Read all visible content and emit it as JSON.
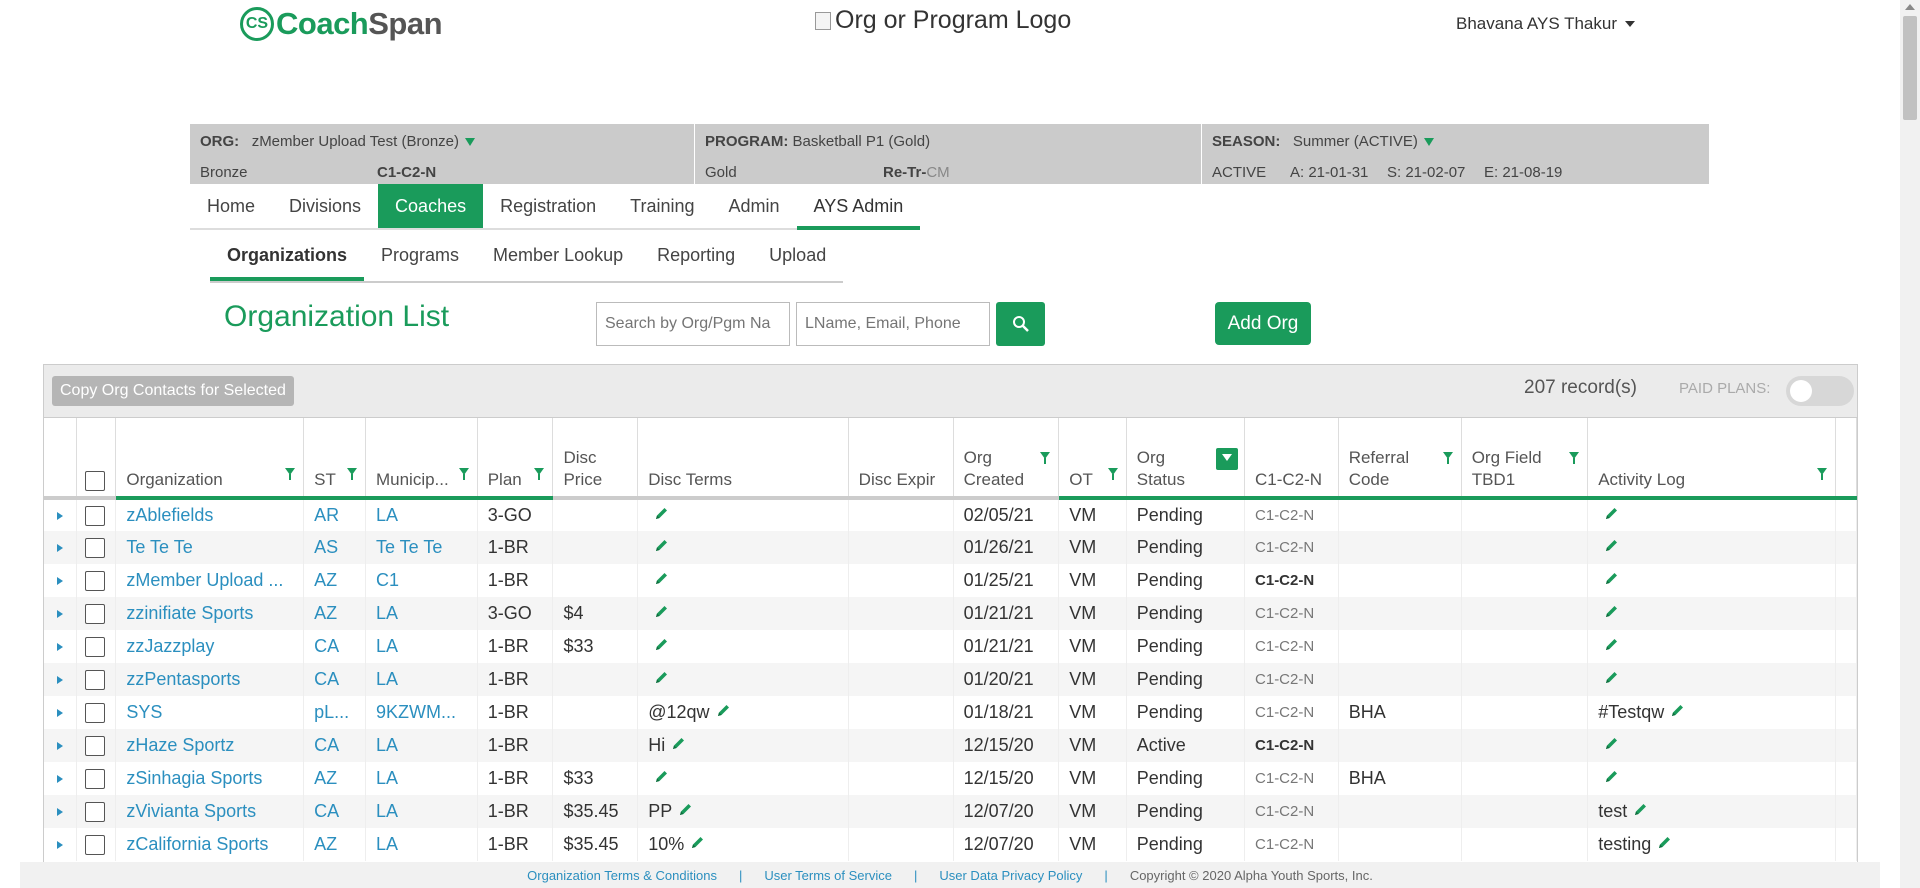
{
  "header": {
    "logo_mark": "CS",
    "logo_c": "Coach",
    "logo_span": "Span",
    "org_logo_alt": "Org or Program Logo",
    "user_name": "Bhavana AYS Thakur"
  },
  "context": {
    "org_label": "ORG:",
    "org_value": "zMember Upload Test (Bronze)",
    "org_level": "Bronze",
    "org_code": "C1-C2-N",
    "program_label": "PROGRAM:",
    "program_value": "Basketball P1 (Gold)",
    "program_level": "Gold",
    "program_code_bold": "Re-Tr-",
    "program_code_light": "CM",
    "season_label": "SEASON:",
    "season_value": "Summer (ACTIVE)",
    "season_status": "ACTIVE",
    "season_a": "A: 21-01-31",
    "season_s": "S: 21-02-07",
    "season_e": "E: 21-08-19"
  },
  "nav": [
    "Home",
    "Divisions",
    "Coaches",
    "Registration",
    "Training",
    "Admin",
    "AYS Admin"
  ],
  "subnav": [
    "Organizations",
    "Programs",
    "Member Lookup",
    "Reporting",
    "Upload"
  ],
  "page_title": "Organization List",
  "search": {
    "org_placeholder": "Search by Org/Pgm Na",
    "contact_placeholder": "LName, Email, Phone"
  },
  "add_org_label": "Add Org",
  "toolbar": {
    "copy_label": "Copy Org Contacts for Selected",
    "records": "207 record(s)",
    "paid_plans_label": "PAID PLANS:"
  },
  "columns": {
    "organization": "Organization",
    "st": "ST",
    "municipality": "Municip...",
    "plan": "Plan",
    "disc_price_1": "Disc",
    "disc_price_2": "Price",
    "disc_terms": "Disc Terms",
    "disc_expir": "Disc Expir",
    "org_created_1": "Org",
    "org_created_2": "Created",
    "ot": "OT",
    "org_status_1": "Org",
    "org_status_2": "Status",
    "c1c2n": "C1-C2-N",
    "referral_1": "Referral",
    "referral_2": "Code",
    "field_1": "Org Field",
    "field_2": "TBD1",
    "activity": "Activity Log"
  },
  "rows": [
    {
      "org": "zAblefields",
      "st": "AR",
      "muni": "LA",
      "plan": "3-GO",
      "price": "",
      "terms": "",
      "created": "02/05/21",
      "ot": "VM",
      "status": "Pending",
      "code": "C1-C2-N",
      "code_bold": false,
      "ref": "",
      "field": "",
      "activity": ""
    },
    {
      "org": "Te Te Te",
      "st": "AS",
      "muni": "Te Te Te",
      "plan": "1-BR",
      "price": "",
      "terms": "",
      "created": "01/26/21",
      "ot": "VM",
      "status": "Pending",
      "code": "C1-C2-N",
      "code_bold": false,
      "ref": "",
      "field": "",
      "activity": ""
    },
    {
      "org": "zMember Upload ...",
      "st": "AZ",
      "muni": "C1",
      "plan": "1-BR",
      "price": "",
      "terms": "",
      "created": "01/25/21",
      "ot": "VM",
      "status": "Pending",
      "code": "C1-C2-N",
      "code_bold": true,
      "ref": "",
      "field": "",
      "activity": ""
    },
    {
      "org": "zzinifiate Sports",
      "st": "AZ",
      "muni": "LA",
      "plan": "3-GO",
      "price": "$4",
      "terms": "",
      "created": "01/21/21",
      "ot": "VM",
      "status": "Pending",
      "code": "C1-C2-N",
      "code_bold": false,
      "ref": "",
      "field": "",
      "activity": ""
    },
    {
      "org": "zzJazzplay",
      "st": "CA",
      "muni": "LA",
      "plan": "1-BR",
      "price": "$33",
      "terms": "",
      "created": "01/21/21",
      "ot": "VM",
      "status": "Pending",
      "code": "C1-C2-N",
      "code_bold": false,
      "ref": "",
      "field": "",
      "activity": ""
    },
    {
      "org": "zzPentasports",
      "st": "CA",
      "muni": "LA",
      "plan": "1-BR",
      "price": "",
      "terms": "",
      "created": "01/20/21",
      "ot": "VM",
      "status": "Pending",
      "code": "C1-C2-N",
      "code_bold": false,
      "ref": "",
      "field": "",
      "activity": ""
    },
    {
      "org": "SYS",
      "st": "pL...",
      "muni": "9KZWM...",
      "plan": "1-BR",
      "price": "",
      "terms": "@12qw",
      "created": "01/18/21",
      "ot": "VM",
      "status": "Pending",
      "code": "C1-C2-N",
      "code_bold": false,
      "ref": "BHA",
      "field": "",
      "activity": "#Testqw"
    },
    {
      "org": "zHaze Sportz",
      "st": "CA",
      "muni": "LA",
      "plan": "1-BR",
      "price": "",
      "terms": "Hi",
      "created": "12/15/20",
      "ot": "VM",
      "status": "Active",
      "code": "C1-C2-N",
      "code_bold": true,
      "ref": "",
      "field": "",
      "activity": ""
    },
    {
      "org": "zSinhagia Sports",
      "st": "AZ",
      "muni": "LA",
      "plan": "1-BR",
      "price": "$33",
      "terms": "",
      "created": "12/15/20",
      "ot": "VM",
      "status": "Pending",
      "code": "C1-C2-N",
      "code_bold": false,
      "ref": "BHA",
      "field": "",
      "activity": ""
    },
    {
      "org": "zVivianta Sports",
      "st": "CA",
      "muni": "LA",
      "plan": "1-BR",
      "price": "$35.45",
      "terms": "PP",
      "created": "12/07/20",
      "ot": "VM",
      "status": "Pending",
      "code": "C1-C2-N",
      "code_bold": false,
      "ref": "",
      "field": "",
      "activity": "test"
    },
    {
      "org": "zCalifornia Sports",
      "st": "AZ",
      "muni": "LA",
      "plan": "1-BR",
      "price": "$35.45",
      "terms": "10%",
      "created": "12/07/20",
      "ot": "VM",
      "status": "Pending",
      "code": "C1-C2-N",
      "code_bold": false,
      "ref": "",
      "field": "",
      "activity": "testing"
    }
  ],
  "footer": {
    "terms": "Organization Terms & Conditions",
    "user_terms": "User Terms of Service",
    "privacy": "User Data Privacy Policy",
    "copyright": "Copyright © 2020 Alpha Youth Sports, Inc.",
    "sep": "|"
  },
  "colors": {
    "accent": "#1a9b5b",
    "link": "#2b8fbf",
    "context_bg": "#cbcbcb"
  },
  "icons": [
    "search-icon",
    "pencil-icon",
    "filter-icon",
    "expand-icon",
    "caret-down-icon"
  ]
}
